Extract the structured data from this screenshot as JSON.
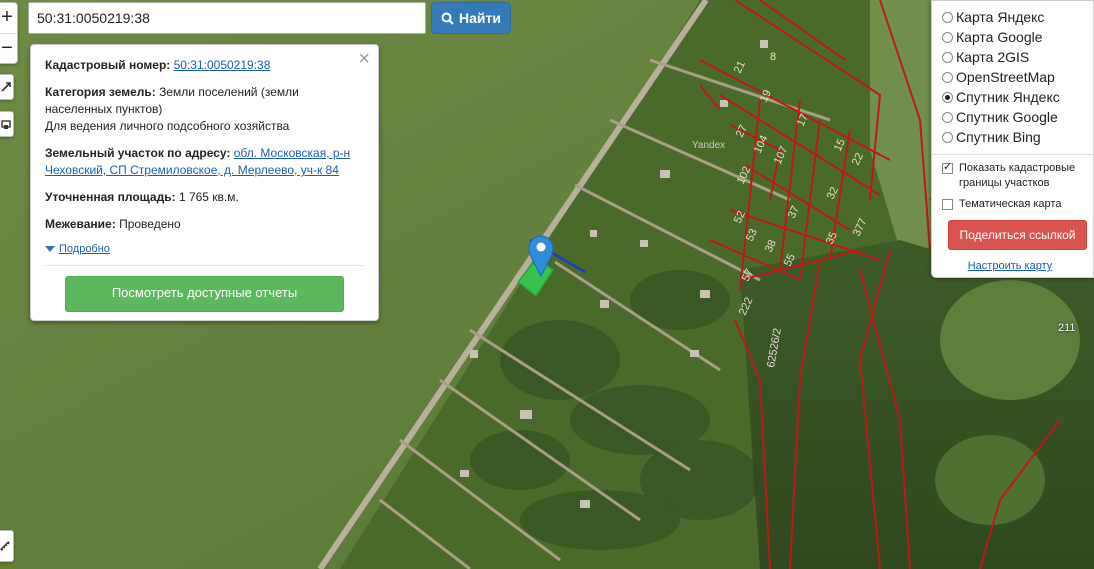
{
  "search": {
    "value": "50:31:0050219:38",
    "button_label": "Найти"
  },
  "zoom": {
    "in_label": "+",
    "out_label": "−"
  },
  "popup": {
    "cadastral_number_label": "Кадастровый номер:",
    "cadastral_number": "50:31:0050219:38",
    "land_category_label": "Категория земель:",
    "land_category": "Земли поселений (земли населенных пунктов)",
    "permitted_use": "Для ведения личного подсобного хозяйства",
    "address_label": "Земельный участок по адресу:",
    "address": "обл. Московская, р-н Чеховский, СП Стремиловское, д. Мерлеево, уч-к 84",
    "area_label": "Уточненная площадь:",
    "area": "1 765 кв.м.",
    "survey_label": "Межевание:",
    "survey": "Проведено",
    "details_link": "Подробно",
    "reports_button": "Посмотреть доступные отчеты",
    "close": "×"
  },
  "layers": {
    "options": [
      {
        "label": "Карта Яндекс",
        "selected": false
      },
      {
        "label": "Карта Google",
        "selected": false
      },
      {
        "label": "Карта 2GIS",
        "selected": false
      },
      {
        "label": "OpenStreetMap",
        "selected": false
      },
      {
        "label": "Спутник Яндекс",
        "selected": true
      },
      {
        "label": "Спутник Google",
        "selected": false
      },
      {
        "label": "Спутник Bing",
        "selected": false
      }
    ],
    "show_borders": "Показать кадастровые границы участков",
    "thematic": "Тематическая карта",
    "share_button": "Поделиться ссылкой",
    "configure_link": "Настроить карту"
  },
  "map": {
    "watermark": "Yandex",
    "parcel_labels": [
      "8",
      "21",
      "19",
      "17",
      "27",
      "104",
      "107",
      "15",
      "22",
      "102",
      "32",
      "52",
      "37",
      "53",
      "38",
      "35",
      "377",
      "57",
      "55",
      "222",
      "62526/2",
      "211"
    ]
  }
}
